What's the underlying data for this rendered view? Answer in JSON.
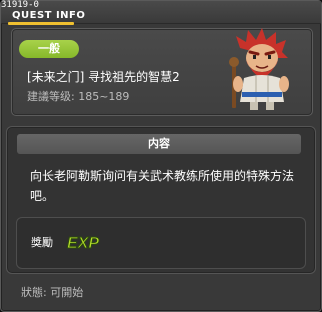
{
  "window": {
    "quest_id": "31919-0",
    "title": "QUEST INFO"
  },
  "quest": {
    "category_badge": "一般",
    "name": "[未来之门] 寻找祖先的智慧2",
    "level_range": "建議等级: 185~189"
  },
  "content": {
    "header": "内容",
    "description": "向长老阿勒斯询问有关武术教练所使用的特殊方法吧。"
  },
  "reward": {
    "label": "獎勵",
    "icon": "exp-icon",
    "icon_text": "EXP"
  },
  "status": {
    "text": "狀態: 可開始"
  },
  "colors": {
    "badge": "#96c43a",
    "accent_yellow": "#f0c030",
    "exp_green": "#b8e02a"
  }
}
